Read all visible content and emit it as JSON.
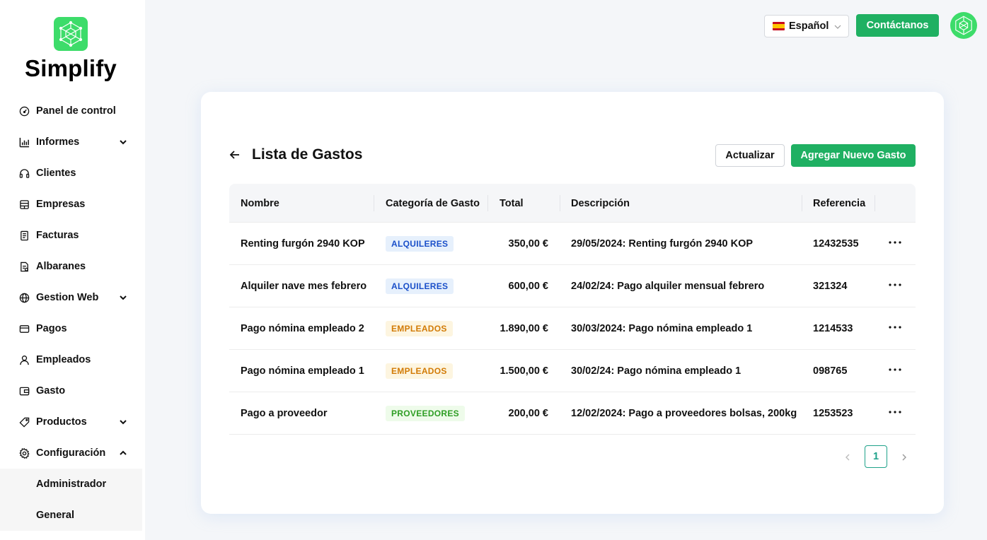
{
  "brand": {
    "name": "Simplify",
    "logo_icon": "network-icon",
    "accent": "#3ddc6a"
  },
  "sidebar": {
    "items": [
      {
        "label": "Panel de control",
        "icon": "dashboard-icon"
      },
      {
        "label": "Informes",
        "icon": "chart-icon",
        "expandable": true
      },
      {
        "label": "Clientes",
        "icon": "headset-icon"
      },
      {
        "label": "Empresas",
        "icon": "building-icon"
      },
      {
        "label": "Facturas",
        "icon": "invoice-icon"
      },
      {
        "label": "Albaranes",
        "icon": "delivery-note-icon"
      },
      {
        "label": "Gestion Web",
        "icon": "globe-icon",
        "expandable": true
      },
      {
        "label": "Pagos",
        "icon": "card-icon"
      },
      {
        "label": "Empleados",
        "icon": "user-icon"
      },
      {
        "label": "Gasto",
        "icon": "wallet-icon"
      },
      {
        "label": "Productos",
        "icon": "tag-icon",
        "expandable": true
      },
      {
        "label": "Configuración",
        "icon": "gear-icon",
        "expanded": true
      }
    ],
    "submenu": [
      {
        "label": "Administrador"
      },
      {
        "label": "General"
      }
    ]
  },
  "topbar": {
    "language": "Español",
    "contact_label": "Contáctanos",
    "primary_color": "#1fb062"
  },
  "page": {
    "title": "Lista de Gastos",
    "refresh_label": "Actualizar",
    "add_label": "Agregar Nuevo Gasto"
  },
  "table": {
    "columns": [
      "Nombre",
      "Categoría de Gasto",
      "Total",
      "Descripción",
      "Referencia"
    ],
    "rows": [
      {
        "name": "Renting furgón 2940 KOP",
        "category": "ALQUILERES",
        "category_color": "blue",
        "total": "350,00 €",
        "description": "29/05/2024: Renting furgón 2940 KOP",
        "reference": "12432535"
      },
      {
        "name": "Alquiler nave mes febrero",
        "category": "ALQUILERES",
        "category_color": "blue",
        "total": "600,00 €",
        "description": "24/02/24: Pago alquiler mensual febrero",
        "reference": "321324"
      },
      {
        "name": "Pago nómina empleado 2",
        "category": "EMPLEADOS",
        "category_color": "orange",
        "total": "1.890,00 €",
        "description": "30/03/2024: Pago nómina empleado 1",
        "reference": "1214533"
      },
      {
        "name": "Pago nómina empleado 1",
        "category": "EMPLEADOS",
        "category_color": "orange",
        "total": "1.500,00 €",
        "description": "30/02/24: Pago nómina empleado 1",
        "reference": "098765"
      },
      {
        "name": "Pago a proveedor",
        "category": "PROVEEDORES",
        "category_color": "green",
        "total": "200,00 €",
        "description": "12/02/2024: Pago a proveedores bolsas, 200kg",
        "reference": "1253523"
      }
    ]
  },
  "pagination": {
    "current_page": "1"
  }
}
